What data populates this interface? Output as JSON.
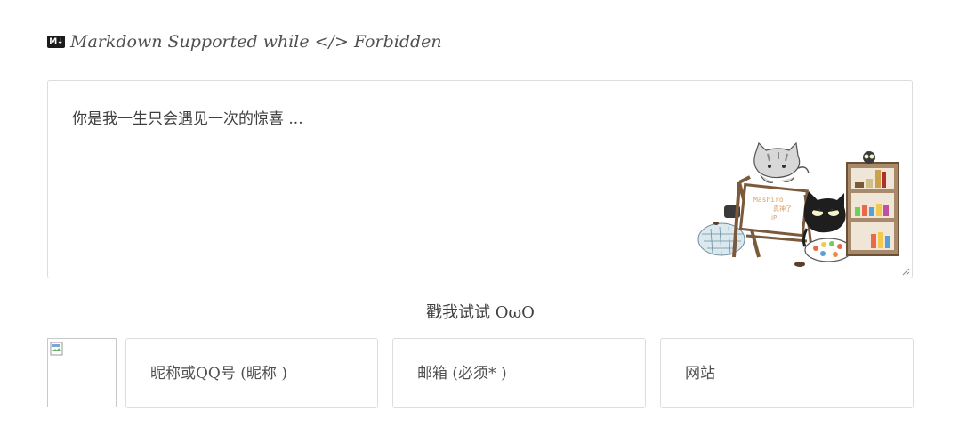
{
  "notice": {
    "icon": "markdown-icon",
    "text": "Markdown Supported while </> Forbidden"
  },
  "comment": {
    "placeholder": "你是我一生只会遇见一次的惊喜 ...",
    "value": "",
    "illustration_text": "Mashiro 真神了 iP"
  },
  "owo": {
    "label": "戳我试试 OωO"
  },
  "form": {
    "avatar_icon": "broken-image-icon",
    "nickname_placeholder": "昵称或QQ号 (昵称 )",
    "email_placeholder": "邮箱 (必须* )",
    "website_placeholder": "网站"
  },
  "colors": {
    "text": "#505050",
    "border": "#dddddd"
  }
}
